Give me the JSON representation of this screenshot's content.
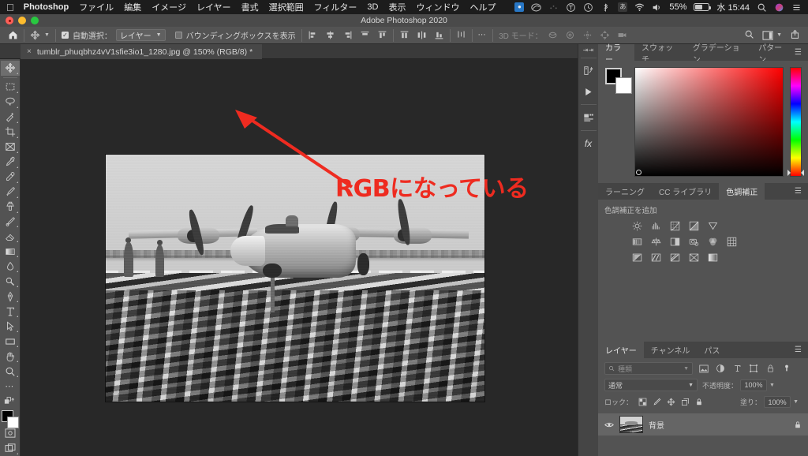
{
  "macos_menubar": {
    "apple_icon": "apple-icon",
    "app_name": "Photoshop",
    "menus": [
      "ファイル",
      "編集",
      "イメージ",
      "レイヤー",
      "書式",
      "選択範囲",
      "フィルター",
      "3D",
      "表示",
      "ウィンドウ",
      "ヘルプ"
    ],
    "status": {
      "dropbox_icon": "dropbox-icon",
      "creative_cloud_icon": "creative-cloud-icon",
      "dots_icon": "dots-icon",
      "textexpander_icon": "circled-t-icon",
      "timemachine_icon": "clock-icon",
      "bluetooth_icon": "bluetooth-icon",
      "input_source": "あ",
      "wifi_icon": "wifi-icon",
      "volume_icon": "volume-icon",
      "battery_percent": "55%",
      "battery_icon": "battery-icon",
      "clock": "水 15:44",
      "search_icon": "search-icon",
      "siri_icon": "siri-icon",
      "controlcenter_icon": "list-icon"
    }
  },
  "window": {
    "title": "Adobe Photoshop 2020",
    "close_button": "close-button",
    "minimize_button": "minimize-button",
    "zoom_button": "zoom-button"
  },
  "options_bar": {
    "home_icon": "home-icon",
    "tool_icon": "move-tool-icon",
    "auto_select_checked": true,
    "auto_select_label": "自動選択：",
    "auto_select_value": "レイヤー",
    "show_bbox_checked": false,
    "show_bbox_label": "バウンディングボックスを表示",
    "more_icon": "more-options-icon",
    "mode_3d_label": "3D モード：",
    "search_icon": "search-icon",
    "workspace_icon": "workspace-icon",
    "share_icon": "share-icon"
  },
  "document_tab": {
    "close_icon": "close-icon",
    "title": "tumblr_phuqbhz4vV1sfie3io1_1280.jpg @ 150% (RGB/8) *"
  },
  "toolbar": {
    "tools": [
      {
        "name": "move-tool",
        "selected": true
      },
      {
        "name": "rectangular-marquee-tool",
        "selected": false
      },
      {
        "name": "lasso-tool",
        "selected": false
      },
      {
        "name": "quick-selection-tool",
        "selected": false
      },
      {
        "name": "crop-tool",
        "selected": false
      },
      {
        "name": "frame-tool",
        "selected": false
      },
      {
        "name": "eyedropper-tool",
        "selected": false
      },
      {
        "name": "spot-healing-brush-tool",
        "selected": false
      },
      {
        "name": "brush-tool",
        "selected": false
      },
      {
        "name": "clone-stamp-tool",
        "selected": false
      },
      {
        "name": "history-brush-tool",
        "selected": false
      },
      {
        "name": "eraser-tool",
        "selected": false
      },
      {
        "name": "gradient-tool",
        "selected": false
      },
      {
        "name": "blur-tool",
        "selected": false
      },
      {
        "name": "dodge-tool",
        "selected": false
      },
      {
        "name": "pen-tool",
        "selected": false
      },
      {
        "name": "type-tool",
        "selected": false
      },
      {
        "name": "path-selection-tool",
        "selected": false
      },
      {
        "name": "rectangle-tool",
        "selected": false
      },
      {
        "name": "hand-tool",
        "selected": false
      },
      {
        "name": "zoom-tool",
        "selected": false
      },
      {
        "name": "edit-toolbar-tool",
        "selected": false
      },
      {
        "name": "default-colors-tool",
        "selected": false
      }
    ],
    "foreground_color": "#000000",
    "background_color": "#ffffff",
    "quick_mask_icon": "quick-mask-icon",
    "screen_mode_icon": "screen-mode-icon"
  },
  "annotation": {
    "text": "RGBになっている",
    "color": "#ee2b20",
    "arrow": "red-arrow"
  },
  "panel_rail": {
    "collapse_icon": "collapse-panels-icon",
    "buttons": [
      "history-icon",
      "play-icon",
      "properties-icon",
      "fx-icon"
    ]
  },
  "color_panel": {
    "tabs": [
      "カラー",
      "スウォッチ",
      "グラデーション",
      "パターン"
    ],
    "active_tab": "カラー",
    "menu_icon": "panel-menu-icon",
    "foreground_color": "#000000",
    "background_color": "#ffffff",
    "hue": "#ff0000"
  },
  "adjustments_panel": {
    "tabs": [
      "ラーニング",
      "CC ライブラリ",
      "色調補正"
    ],
    "active_tab": "色調補正",
    "menu_icon": "panel-menu-icon",
    "section_label": "色調補正を追加",
    "rows": [
      [
        "brightness-contrast-icon",
        "levels-icon",
        "curves-icon",
        "exposure-icon",
        "vibrance-icon"
      ],
      [
        "hue-saturation-icon",
        "color-balance-icon",
        "black-white-icon",
        "photo-filter-icon",
        "channel-mixer-icon",
        "color-lookup-icon"
      ],
      [
        "invert-icon",
        "posterize-icon",
        "threshold-icon",
        "gradient-map-icon",
        "selective-color-icon"
      ]
    ]
  },
  "layers_panel": {
    "tabs": [
      "レイヤー",
      "チャンネル",
      "パス"
    ],
    "active_tab": "レイヤー",
    "menu_icon": "panel-menu-icon",
    "filter_placeholder": "種類",
    "filter_icons": [
      "pixel-filter-icon",
      "adjustment-filter-icon",
      "type-filter-icon",
      "shape-filter-icon",
      "smartobject-filter-icon"
    ],
    "filter_toggle_icon": "filter-toggle-icon",
    "blend_mode": "通常",
    "opacity_label": "不透明度：",
    "opacity_value": "100%",
    "lock_label": "ロック：",
    "lock_icons": [
      "lock-transparent-icon",
      "lock-image-icon",
      "lock-position-icon",
      "lock-artboard-icon",
      "lock-all-icon"
    ],
    "fill_label": "塗り：",
    "fill_value": "100%",
    "layers": [
      {
        "visible_icon": "eye-icon",
        "thumbnail": "layer-thumbnail",
        "name": "背景",
        "locked_icon": "lock-icon"
      }
    ]
  }
}
